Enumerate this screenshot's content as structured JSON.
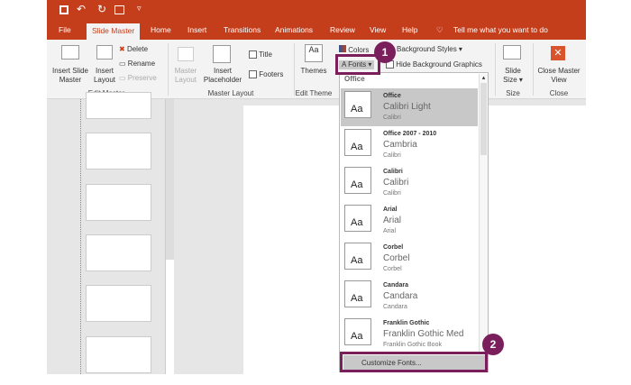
{
  "qat": {
    "save": "save-icon",
    "undo": "undo-icon",
    "redo": "redo-icon",
    "present": "present-icon",
    "customize": "▿"
  },
  "tabs": [
    "File",
    "Slide Master",
    "Home",
    "Insert",
    "Transitions",
    "Animations",
    "Review",
    "View",
    "Help"
  ],
  "tell_me": "Tell me what you want to do",
  "ribbon": {
    "insert_slide_master": "Insert Slide Master",
    "insert_layout": "Insert Layout",
    "delete": "Delete",
    "rename": "Rename",
    "preserve": "Preserve",
    "edit_master": "Edit Master",
    "master_layout_btn": "Master Layout",
    "insert_placeholder": "Insert Placeholder",
    "title": "Title",
    "footers": "Footers",
    "master_layout": "Master Layout",
    "themes": "Themes",
    "edit_theme": "Edit Theme",
    "colors": "Colors",
    "fonts": "Fonts",
    "background_styles": "Background Styles",
    "hide_background_graphics": "Hide Background Graphics",
    "slide_size": "Slide Size",
    "size": "Size",
    "close_master_view": "Close Master View",
    "close": "Close"
  },
  "dropdown": {
    "header": "Office",
    "items": [
      {
        "name": "Office",
        "heading": "Calibri Light",
        "body": "Calibri",
        "selected": true
      },
      {
        "name": "Office 2007 - 2010",
        "heading": "Cambria",
        "body": "Calibri"
      },
      {
        "name": "Calibri",
        "heading": "Calibri",
        "body": "Calibri"
      },
      {
        "name": "Arial",
        "heading": "Arial",
        "body": "Arial"
      },
      {
        "name": "Corbel",
        "heading": "Corbel",
        "body": "Corbel"
      },
      {
        "name": "Candara",
        "heading": "Candara",
        "body": "Candara"
      },
      {
        "name": "Franklin Gothic",
        "heading": "Franklin Gothic Med",
        "body": "Franklin Gothic Book"
      }
    ],
    "preview": "Aa",
    "customize": "Customize Fonts..."
  },
  "badges": [
    "1",
    "2"
  ],
  "colors": {
    "accent": "#c43e1c",
    "callout": "#7b1f5c"
  }
}
